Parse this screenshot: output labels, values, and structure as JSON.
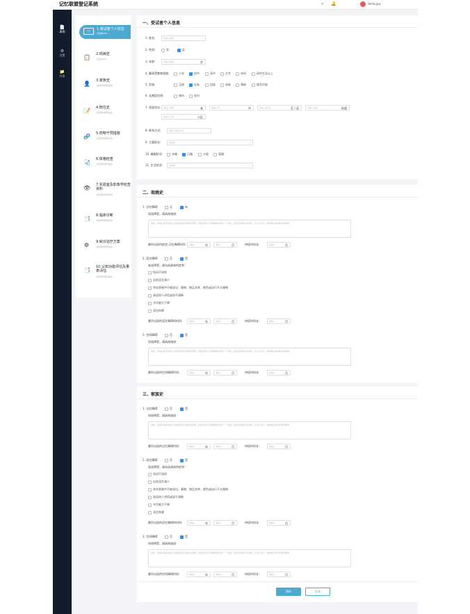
{
  "app": {
    "title": "记忆联盟登记系统",
    "user": "Hello,guy"
  },
  "nav": [
    {
      "label": "表例",
      "icon": "📄"
    },
    {
      "label": "设置",
      "icon": "⚙"
    },
    {
      "label": "共享",
      "icon": "📁"
    }
  ],
  "steps": [
    {
      "title": "1.受试者个人信息",
      "sub": "已完成40%",
      "icon": "▭"
    },
    {
      "title": "2.现病史",
      "sub": "已完成40%",
      "icon": "📋"
    },
    {
      "title": "3.家族史",
      "sub": "点击预约填写信息",
      "icon": "👤"
    },
    {
      "title": "4.既往史",
      "sub": "点击预约填写信息",
      "icon": "📝"
    },
    {
      "title": "5.药物干预措施",
      "sub": "点击预约填写信息",
      "icon": "🧬"
    },
    {
      "title": "6.体格检查",
      "sub": "点击预约填写信息",
      "icon": "🩺"
    },
    {
      "title": "7.实验室及影像学检查资料",
      "sub": "点击预约填写信息",
      "icon": "👁"
    },
    {
      "title": "8.临床诊断",
      "sub": "点击预约填写信息",
      "icon": "📑"
    },
    {
      "title": "9.就诊治疗方案",
      "sub": "点击预约填写信息",
      "icon": "⚙"
    },
    {
      "title": "10.认知功能评估及量表评估",
      "sub": "点击预约填写信息",
      "icon": "📑"
    }
  ],
  "s1": {
    "title": "一、受试者个人信息",
    "q_name": "1. 姓名:",
    "name_ph": "请输入姓名",
    "q_sex": "2. 性别:",
    "sex_opts": [
      "男",
      "女"
    ],
    "q_age": "3. 年龄:",
    "age_ph": "请输入年龄",
    "age_unit": "岁",
    "q_edu": "4. 最高受教育程度:",
    "edu_opts": [
      "小学",
      "初中",
      "高中",
      "大专",
      "本科",
      "研究生及以上"
    ],
    "q_eth": "5. 民族:",
    "eth_opts": [
      "汉族",
      "壮族",
      "回族",
      "苗族",
      "满族",
      "维吾尔族"
    ],
    "q_res": "6. 长期居住地:",
    "res_opts": [
      "城市",
      "农村"
    ],
    "q_addr": "7. 家庭住址:",
    "addr_ph": "请输入省份",
    "prov": "省",
    "city_ph": "请输入市",
    "city": "市",
    "dist_ph": "请输入区/县",
    "dist": "区 / 县",
    "town_ph": "请输入街道",
    "town": "街道",
    "vill_ph": "请输入小区",
    "vill": "小区",
    "q_contact": "8. 联系方式:",
    "contact_ph": "请输入联系方式",
    "q_job": "9. 主要职业:",
    "job_ph": "请选择",
    "q_mar": "10. 婚姻状况:",
    "mar_opts": [
      "未婚",
      "已婚",
      "分居",
      "离婚"
    ],
    "q_life": "11. 生活状况:",
    "life_ph": "请选择"
  },
  "s2": {
    "title": "二、现病史",
    "q1": "1. 记忆障碍:",
    "yn": [
      "无",
      "有"
    ],
    "q1_hint": "如选择是，请具体描述:",
    "ta_ph": "例如，他(她)是否经常忘记他(她)把东西放在哪里；是否经常记不得刚刚说过的一个词语，而且说话或请问问题，又怎么表示；或等等活动中的其他事件",
    "q1_first": "最早出现时症状:记忆障碍时间:",
    "yr_ph": "请输入",
    "yr": "年",
    "mo_ph": "请输入",
    "mo": "月",
    "q1_dur": "持续时间长:",
    "dur_ph": "请输入",
    "dur": "月",
    "q2": "2. 语言障碍:",
    "q2_yn": [
      "否",
      "是"
    ],
    "q2_hint": "若选择是，请勾选具体的症状:",
    "q2_opts": [
      "找词不流利",
      "自发语言减少",
      "命名困难中不能说出：事物、物品名称、颜色或自行不太顺畅",
      "阅读他人讲话或说不清晰",
      "书写能力下降",
      "语言构建"
    ],
    "q2_first": "最早出现的语言障碍的时间:",
    "yr_ph2": "请输入",
    "yr2": "年",
    "mo_ph2": "请输入",
    "mo2": "月",
    "q2_dur": "持续时间长:",
    "dur_ph2": "请输入",
    "dur2": "月",
    "q3": "3. 空间障碍:",
    "q3_yn": [
      "否",
      "是"
    ],
    "q3_hint": "如选择是，请具体描述:",
    "ta_ph3": "例如，他(她)是否经常忘记他(她)把东西放在哪里；是否经常记不得刚刚说过的一个词语，而且说话或请问问题，又怎么表示；或等等活动中的其他事件",
    "q3_first": "最早出现的空间障碍时间:",
    "yr_ph3": "请输入",
    "yr3": "年",
    "mo_ph3": "请输入",
    "mo3": "月",
    "q3_dur": "持续时间长:",
    "dur_ph3": "请输入",
    "dur3": "月"
  },
  "s3": {
    "title": "三、家族史",
    "q1": "1. 记忆障碍:",
    "yn": [
      "否",
      "是"
    ],
    "q1_hint": "如选择是，请具体描述:",
    "ta_ph": "例如，他(她)是否经常忘记他(她)把东西放在哪里；是否经常记不得刚刚说过的一个词语，而且说话或请问问题，又怎么表示；或等等活动中的其他事件",
    "q1_first": "最早出现的记忆障碍时间:",
    "yr_ph": "请输入",
    "yr": "年",
    "mo_ph": "请输入",
    "mo": "月",
    "q1_dur": "持续时间长:",
    "dur_ph": "请输入",
    "dur": "月",
    "q2": "2. 语言障碍:",
    "q2_yn": [
      "否",
      "是"
    ],
    "q2_hint": "若选择是，请勾选具体的症状:",
    "q2_opts": [
      "找词不流利",
      "自发语言减少",
      "命名困难中不能说出：事物、物品名称、颜色或自行不太顺畅",
      "阅读他人讲话或说不清晰",
      "书写能力下降",
      "语言构建"
    ],
    "q2_first": "最早出现的语言障碍的时间:",
    "yr_ph2": "请输入",
    "yr2": "年",
    "mo_ph2": "请输入",
    "mo2": "月",
    "q2_dur": "持续时间长:",
    "dur_ph2": "请输入",
    "dur2": "月",
    "q3": "3. 空间障碍:",
    "q3_yn": [
      "否",
      "是"
    ],
    "q3_hint": "如选择是，请具体描述:",
    "ta_ph3": "例如，他(她)是否经常忘记他(她)把东西放在哪里；是否经常记不得刚刚说过的一个词语，而且说话或请问问题，又怎么表示；或等等活动中的其他事件",
    "q3_first": "最早出现的空间障碍时间:",
    "yr_ph3": "请输入",
    "yr3": "年",
    "mo_ph3": "请输入",
    "mo3": "月",
    "q3_dur": "持续时间长:",
    "dur_ph3": "请输入",
    "dur3": "月"
  },
  "actions": {
    "save": "保存",
    "gen": "生成"
  },
  "colors": {
    "accent": "#4da9d2",
    "nav": "#111c2b",
    "check": "#3a8ee6"
  }
}
